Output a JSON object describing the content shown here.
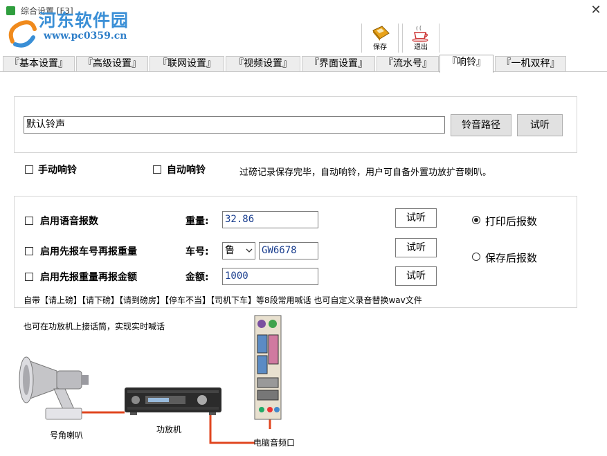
{
  "window": {
    "title": "综合设置 [F3]",
    "close_glyph": "✕",
    "watermark_line1": "河东软件园",
    "watermark_line2": "www.pc0359.cn"
  },
  "toolbar": {
    "save_label": "保存",
    "exit_label": "退出",
    "save_icon": "floppy-icon",
    "exit_icon": "coffee-icon"
  },
  "tabs": [
    {
      "label": "『基本设置』",
      "active": false
    },
    {
      "label": "『高级设置』",
      "active": false
    },
    {
      "label": "『联网设置』",
      "active": false
    },
    {
      "label": "『视频设置』",
      "active": false
    },
    {
      "label": "『界面设置』",
      "active": false
    },
    {
      "label": "『流水号』",
      "active": false
    },
    {
      "label": "『响铃』",
      "active": true
    },
    {
      "label": "『一机双秤』",
      "active": false
    }
  ],
  "ringtone": {
    "value": "默认铃声",
    "path_button": "铃音路径",
    "listen_button": "试听"
  },
  "ring_options": {
    "manual": {
      "label": "手动响铃",
      "checked": false
    },
    "auto": {
      "label": "自动响铃",
      "checked": false
    },
    "hint": "过磅记录保存完毕，自动响铃，用户可自备外置功放扩音喇叭。"
  },
  "voice": {
    "enable_voice": {
      "label": "启用语音报数",
      "checked": false
    },
    "plate_then_weight": {
      "label": "启用先报车号再报重量",
      "checked": false
    },
    "weight_then_amount": {
      "label": "启用先报重量再报金额",
      "checked": false
    },
    "weight_label": "重量:",
    "weight_value": "32.86",
    "plate_label": "车号:",
    "plate_prefix": "鲁",
    "plate_value": "GW6678",
    "amount_label": "金额:",
    "amount_value": "1000",
    "listen_button": "试听",
    "print_then_report": {
      "label": "打印后报数",
      "selected": true
    },
    "save_then_report": {
      "label": "保存后报数",
      "selected": false
    },
    "footnote": "自带【请上磅】【请下磅】【请到磅房】【停车不当】【司机下车】等8段常用喊话 也可自定义录音替换wav文件"
  },
  "diagram": {
    "caption": "也可在功放机上接话筒，实现实时喊话",
    "horn_label": "号角喇叭",
    "amp_label": "功放机",
    "pc_label": "电脑音频口",
    "wire_color": "#e0461f"
  }
}
